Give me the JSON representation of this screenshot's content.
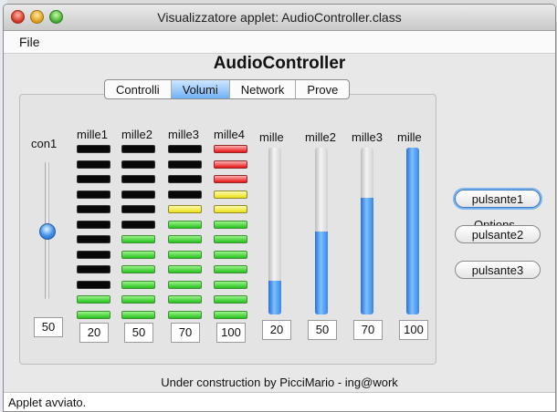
{
  "window": {
    "title": "Visualizzatore applet: AudioController.class"
  },
  "menu": {
    "file": "File"
  },
  "app": {
    "title": "AudioController"
  },
  "tabs": [
    {
      "label": "Controlli",
      "active": false
    },
    {
      "label": "Volumi",
      "active": true
    },
    {
      "label": "Network",
      "active": false
    },
    {
      "label": "Prove",
      "active": false
    }
  ],
  "slider": {
    "label": "con1",
    "value": "50",
    "level": 50
  },
  "led_meters": [
    {
      "label": "mille1",
      "value": "20",
      "level": 20
    },
    {
      "label": "mille2",
      "value": "50",
      "level": 50
    },
    {
      "label": "mille3",
      "value": "70",
      "level": 70
    },
    {
      "label": "mille4",
      "value": "100",
      "level": 100
    }
  ],
  "bar_meters": [
    {
      "label": "mille",
      "value": "20",
      "level": 20
    },
    {
      "label": "mille2",
      "value": "50",
      "level": 50
    },
    {
      "label": "mille3",
      "value": "70",
      "level": 70
    },
    {
      "label": "mille",
      "value": "100",
      "level": 100
    }
  ],
  "options": {
    "label": "Options",
    "buttons": [
      {
        "label": "pulsante1",
        "focused": true
      },
      {
        "label": "pulsante2",
        "focused": false
      },
      {
        "label": "pulsante3",
        "focused": false
      }
    ]
  },
  "footer": "Under construction by PicciMario - ing@work",
  "status": "Applet avviato.",
  "colors": {
    "active_tab": "#6fb1f4",
    "led_green": "#27c11d",
    "led_yellow": "#ebe014",
    "led_red": "#e81212",
    "bar_fill": "#3a86e6"
  }
}
